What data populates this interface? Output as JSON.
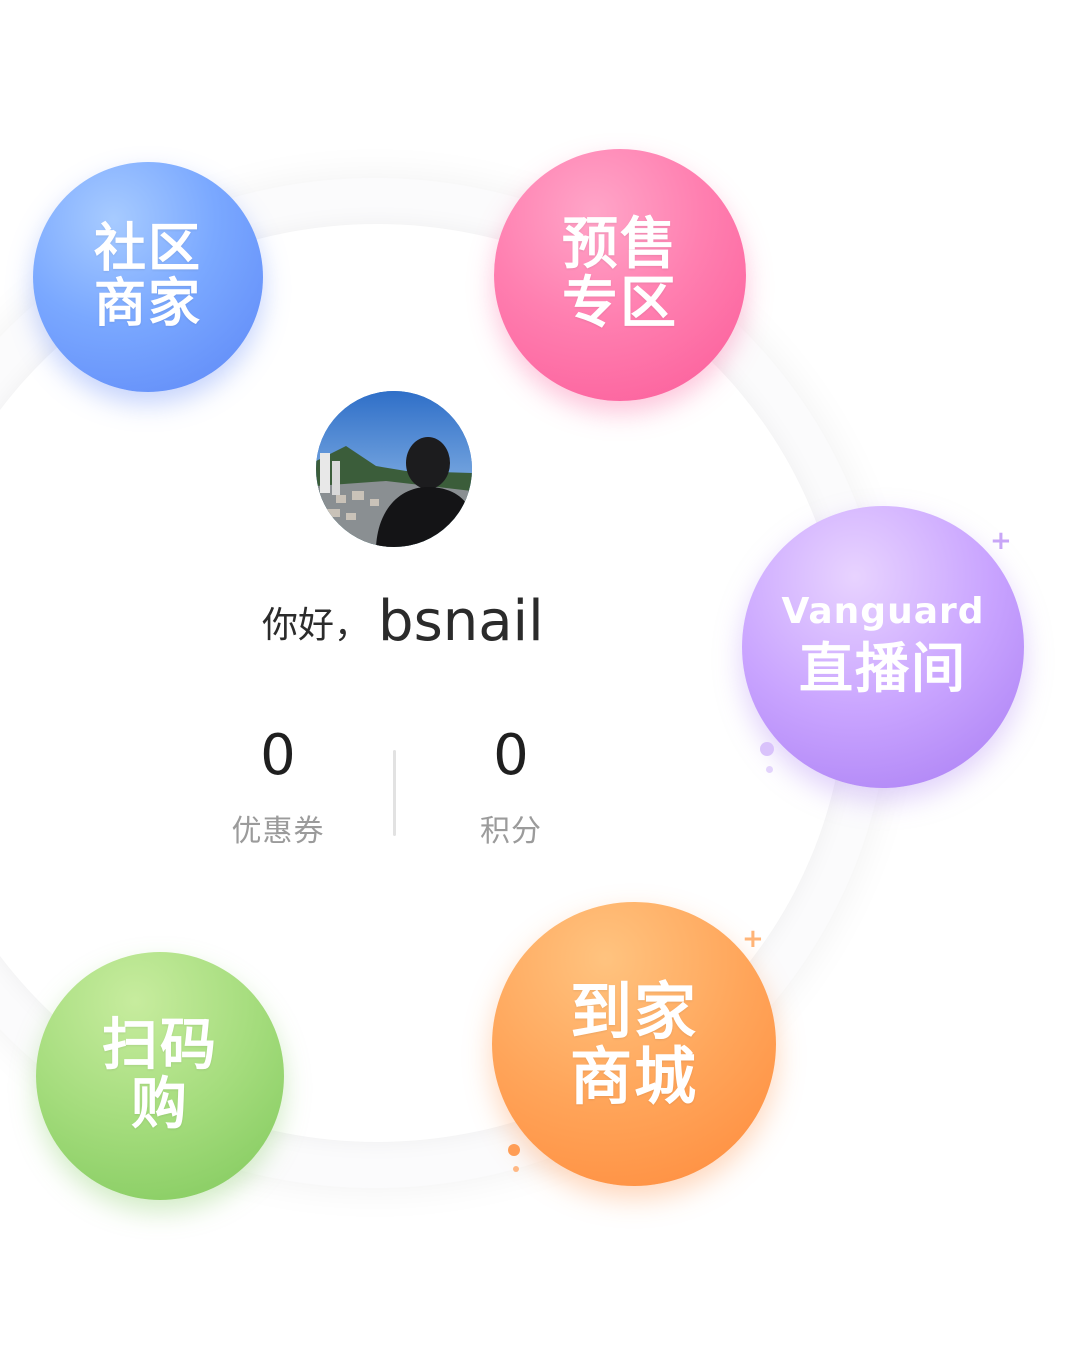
{
  "profile": {
    "greeting": "你好，",
    "username": "bsnail"
  },
  "stats": [
    {
      "value": "0",
      "label": "优惠券"
    },
    {
      "value": "0",
      "label": "积分"
    }
  ],
  "bubbles": {
    "community": {
      "line1": "社区",
      "line2": "商家",
      "color": "#6f9cfb"
    },
    "presale": {
      "line1": "预售",
      "line2": "专区",
      "color": "#fb6aa4"
    },
    "live": {
      "brand": "Vanguard",
      "title": "直播间",
      "color": "#b88af5"
    },
    "scan": {
      "line1": "扫码",
      "line2": "购",
      "color": "#94d26c"
    },
    "mall": {
      "line1": "到家",
      "line2": "商城",
      "color": "#ff9a4a"
    }
  },
  "icons": {
    "avatar": "user-avatar-photo",
    "sparkle": "plus-sparkle-icon"
  }
}
